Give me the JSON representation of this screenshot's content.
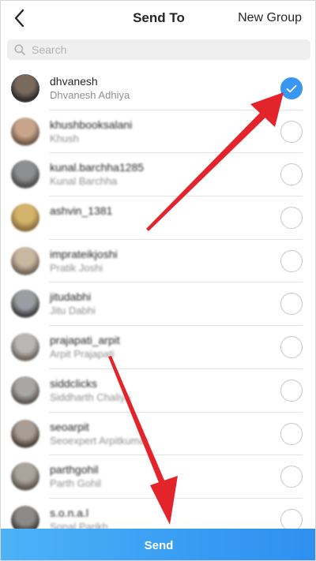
{
  "header": {
    "title": "Send To",
    "new_group_label": "New Group",
    "back_icon": "chevron-left-icon"
  },
  "search": {
    "placeholder": "Search",
    "value": "",
    "icon": "search-icon"
  },
  "contacts": [
    {
      "username": "dhvanesh",
      "full_name": "Dhvanesh Adhiya",
      "selected": true
    },
    {
      "username": "khushbooksalani",
      "full_name": "Khush",
      "selected": false
    },
    {
      "username": "kunal.barchha1285",
      "full_name": "Kunal Barchha",
      "selected": false
    },
    {
      "username": "ashvin_1381",
      "full_name": "",
      "selected": false
    },
    {
      "username": "imprateikjoshi",
      "full_name": "Pratik Joshi",
      "selected": false
    },
    {
      "username": "jitudabhi",
      "full_name": "Jitu Dabhi",
      "selected": false
    },
    {
      "username": "prajapati_arpit",
      "full_name": "Arpit Prajapati",
      "selected": false
    },
    {
      "username": "siddclicks",
      "full_name": "Siddharth Chaliya",
      "selected": false
    },
    {
      "username": "seoarpit",
      "full_name": "Seoexpert Arpitkumar",
      "selected": false
    },
    {
      "username": "parthgohil",
      "full_name": "Parth Gohil",
      "selected": false
    },
    {
      "username": "s.o.n.a.l",
      "full_name": "Sonal Parikh",
      "selected": false
    }
  ],
  "footer": {
    "send_label": "Send"
  },
  "colors": {
    "accent": "#3897f0",
    "annotation_arrow": "#e3242b"
  }
}
